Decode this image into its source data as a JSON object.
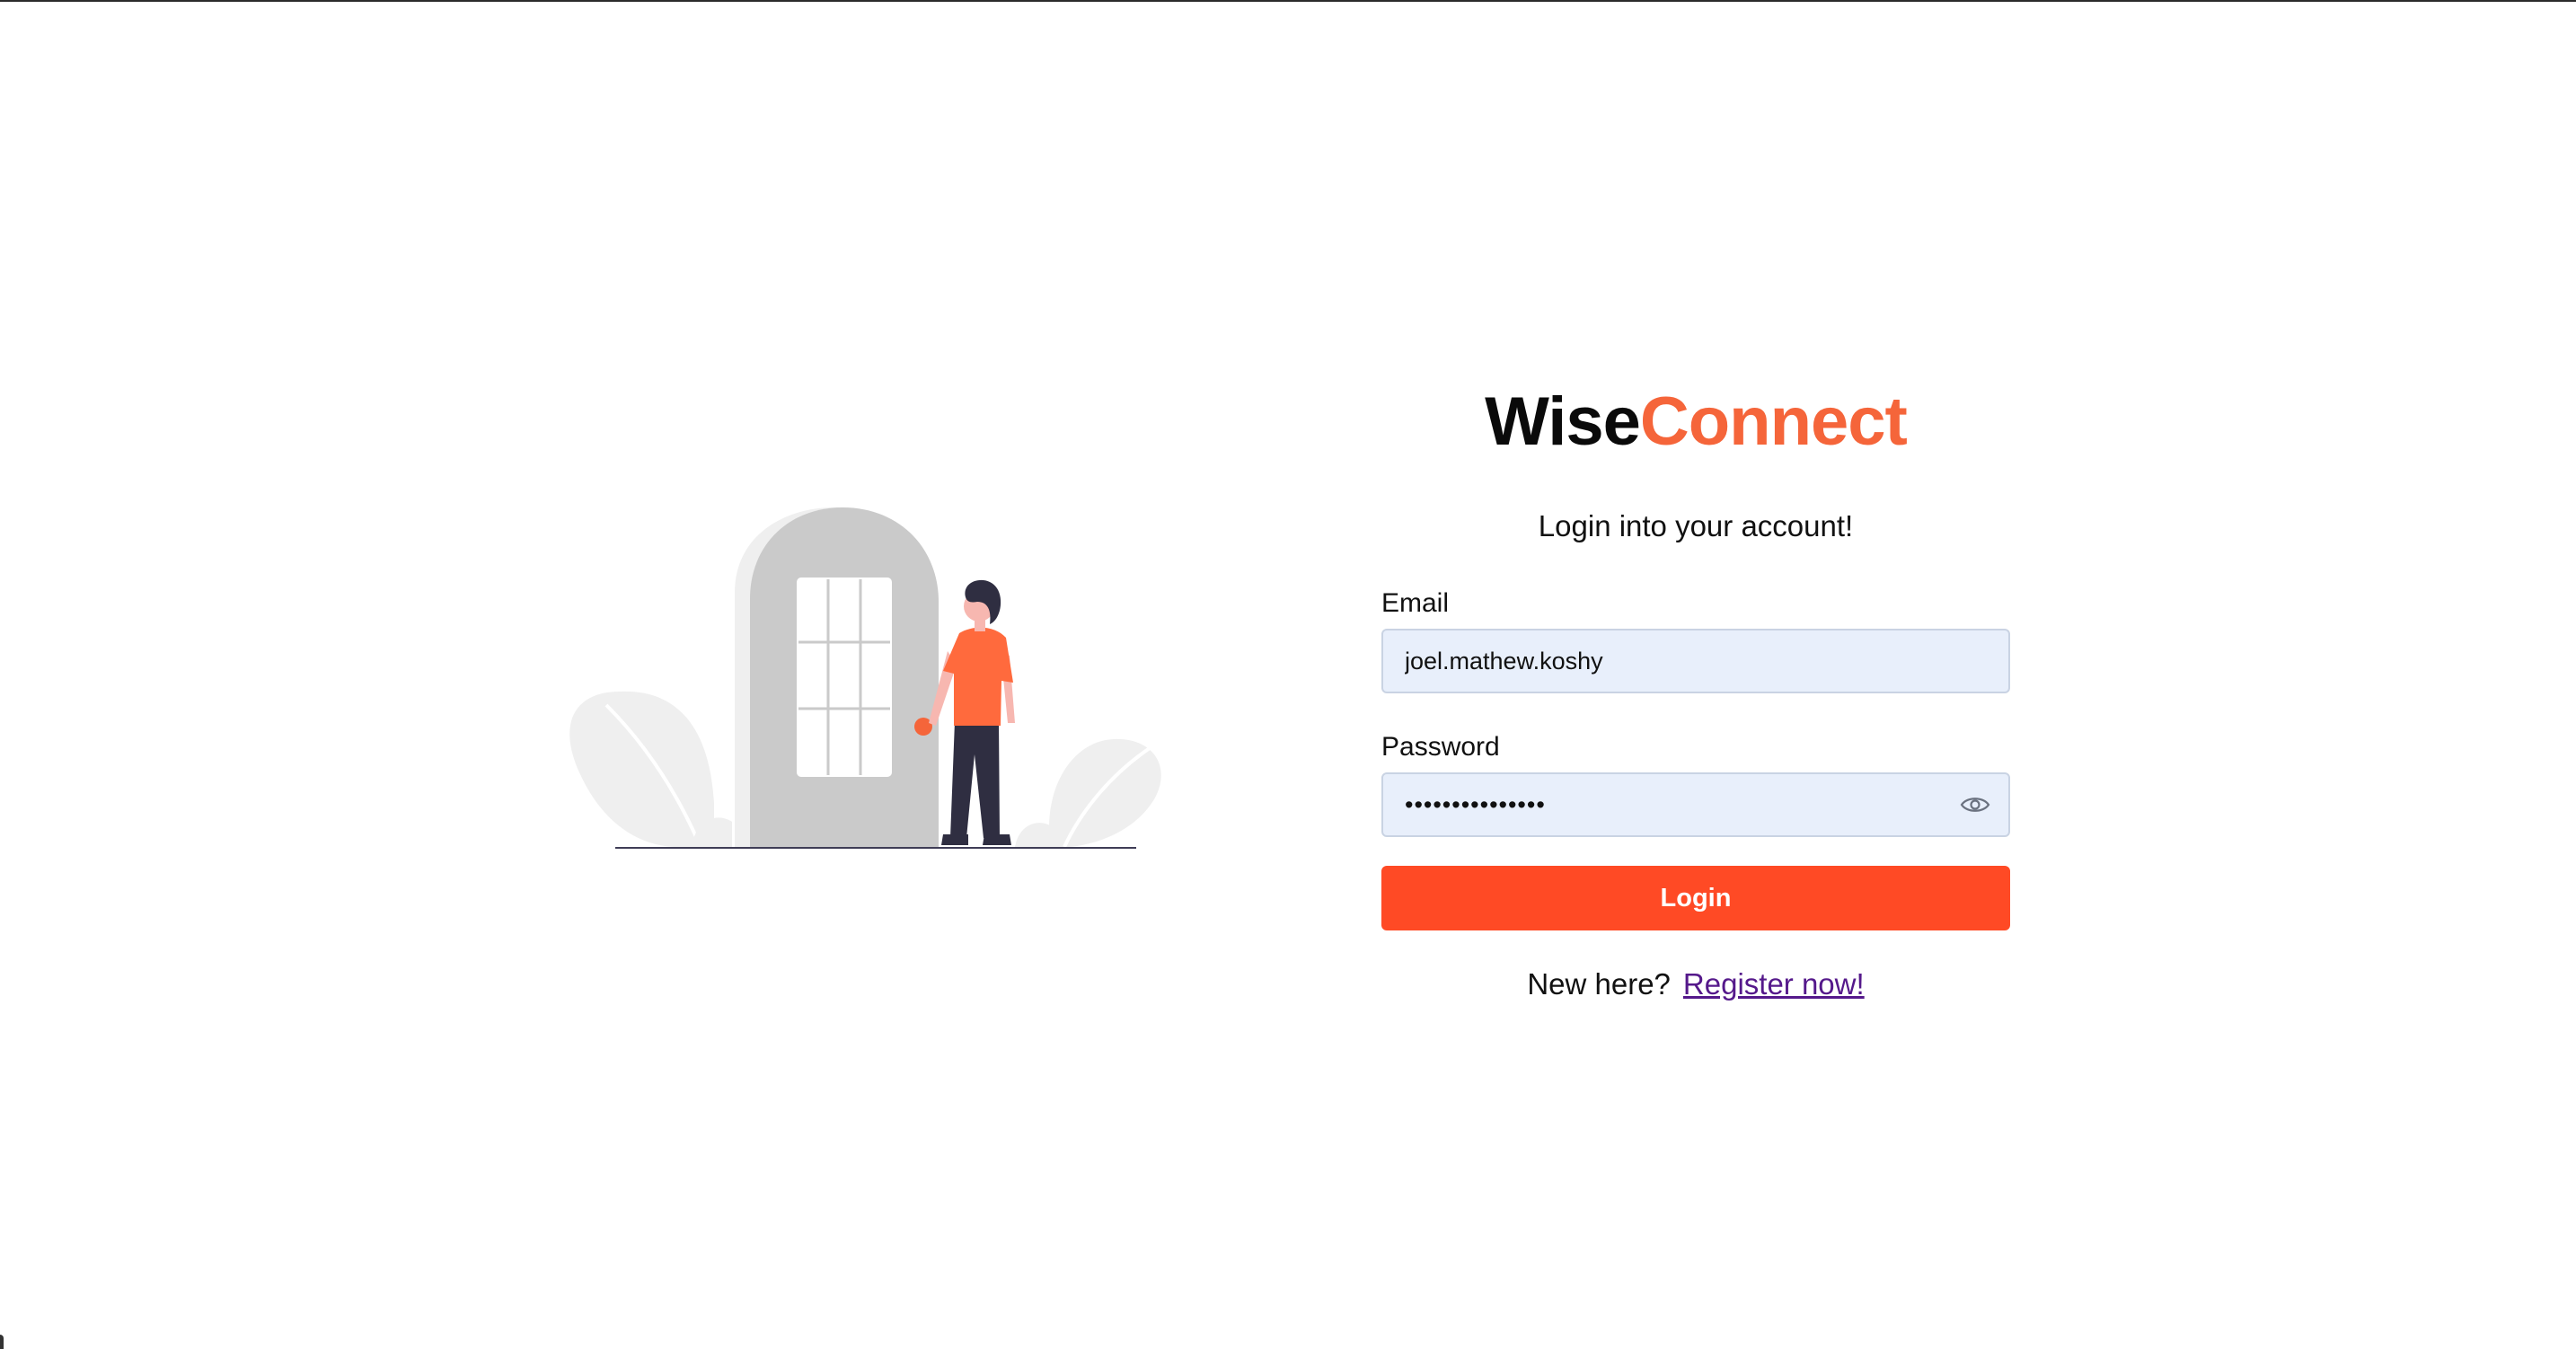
{
  "brand": {
    "part1": "Wise",
    "part2": "Connect"
  },
  "subtitle": "Login into your account!",
  "email": {
    "label": "Email",
    "value": "joel.mathew.koshy"
  },
  "password": {
    "label": "Password",
    "value": "•••••••••••••••",
    "toggle_icon": "eye-icon"
  },
  "login_button": "Login",
  "register": {
    "prompt": "New here?",
    "link": "Register now!"
  },
  "colors": {
    "brand_dark": "#0a0a0a",
    "brand_accent": "#f5653a",
    "button": "#ff4a25",
    "input_bg": "#e8effb",
    "link": "#55198b"
  }
}
